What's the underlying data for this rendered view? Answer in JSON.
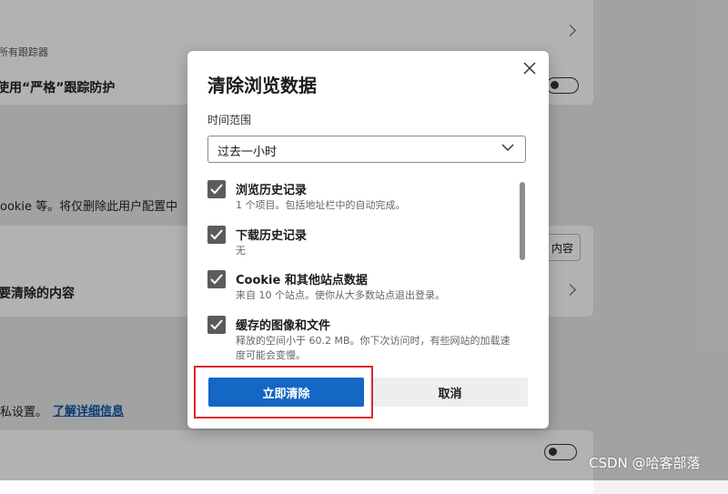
{
  "background": {
    "tracker_label_partial": "所有跟踪器",
    "strict_label_partial": "使用“严格”跟踪防护",
    "cookie_text_partial": "ookie 等。将仅删除此用户配置中",
    "clear_what_partial": "要清除的内容",
    "clear_button_partial": "内容",
    "privacy_text_partial": "私设置。",
    "learn_more_link": "了解详细信息"
  },
  "dialog": {
    "title": "清除浏览数据",
    "close_icon": "close-icon",
    "time_range_label": "时间范围",
    "time_range_value": "过去一小时",
    "items": [
      {
        "title": "浏览历史记录",
        "desc": "1 个项目。包括地址栏中的自动完成。",
        "checked": true
      },
      {
        "title": "下载历史记录",
        "desc": "无",
        "checked": true
      },
      {
        "title": "Cookie 和其他站点数据",
        "desc": "来自 10 个站点。使你从大多数站点退出登录。",
        "checked": true
      },
      {
        "title": "缓存的图像和文件",
        "desc": "释放的空间小于 60.2 MB。你下次访问时，有些网站的加载速度可能会变慢。",
        "checked": true
      }
    ],
    "clear_now_label": "立即清除",
    "cancel_label": "取消"
  },
  "colors": {
    "primary": "#1467c3",
    "highlight": "#e0292a",
    "checkbox": "#5b5b5b"
  },
  "watermark": "CSDN @哈客部落"
}
